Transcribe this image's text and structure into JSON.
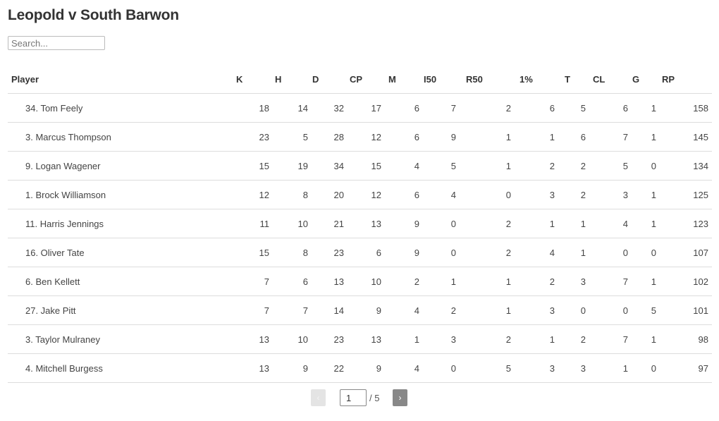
{
  "page": {
    "title": "Leopold v South Barwon",
    "search_placeholder": "Search..."
  },
  "table": {
    "columns": [
      "Player",
      "K",
      "H",
      "D",
      "CP",
      "M",
      "I50",
      "R50",
      "1%",
      "T",
      "CL",
      "G",
      "RP"
    ],
    "rows": [
      {
        "player": "34. Tom Feely",
        "stats": [
          "18",
          "14",
          "32",
          "17",
          "6",
          "7",
          "2",
          "6",
          "5",
          "6",
          "1",
          "158"
        ]
      },
      {
        "player": "3. Marcus Thompson",
        "stats": [
          "23",
          "5",
          "28",
          "12",
          "6",
          "9",
          "1",
          "1",
          "6",
          "7",
          "1",
          "145"
        ]
      },
      {
        "player": "9. Logan Wagener",
        "stats": [
          "15",
          "19",
          "34",
          "15",
          "4",
          "5",
          "1",
          "2",
          "2",
          "5",
          "0",
          "134"
        ]
      },
      {
        "player": "1. Brock Williamson",
        "stats": [
          "12",
          "8",
          "20",
          "12",
          "6",
          "4",
          "0",
          "3",
          "2",
          "3",
          "1",
          "125"
        ]
      },
      {
        "player": "11. Harris Jennings",
        "stats": [
          "11",
          "10",
          "21",
          "13",
          "9",
          "0",
          "2",
          "1",
          "1",
          "4",
          "1",
          "123"
        ]
      },
      {
        "player": "16. Oliver Tate",
        "stats": [
          "15",
          "8",
          "23",
          "6",
          "9",
          "0",
          "2",
          "4",
          "1",
          "0",
          "0",
          "107"
        ]
      },
      {
        "player": "6. Ben Kellett",
        "stats": [
          "7",
          "6",
          "13",
          "10",
          "2",
          "1",
          "1",
          "2",
          "3",
          "7",
          "1",
          "102"
        ]
      },
      {
        "player": "27. Jake Pitt",
        "stats": [
          "7",
          "7",
          "14",
          "9",
          "4",
          "2",
          "1",
          "3",
          "0",
          "0",
          "5",
          "101"
        ]
      },
      {
        "player": "3. Taylor Mulraney",
        "stats": [
          "13",
          "10",
          "23",
          "13",
          "1",
          "3",
          "2",
          "1",
          "2",
          "7",
          "1",
          "98"
        ]
      },
      {
        "player": "4. Mitchell Burgess",
        "stats": [
          "13",
          "9",
          "22",
          "9",
          "4",
          "0",
          "5",
          "3",
          "3",
          "1",
          "0",
          "97"
        ]
      }
    ]
  },
  "pagination": {
    "prev_label": "‹",
    "next_label": "›",
    "current_page": "1",
    "total_label": "/ 5"
  }
}
